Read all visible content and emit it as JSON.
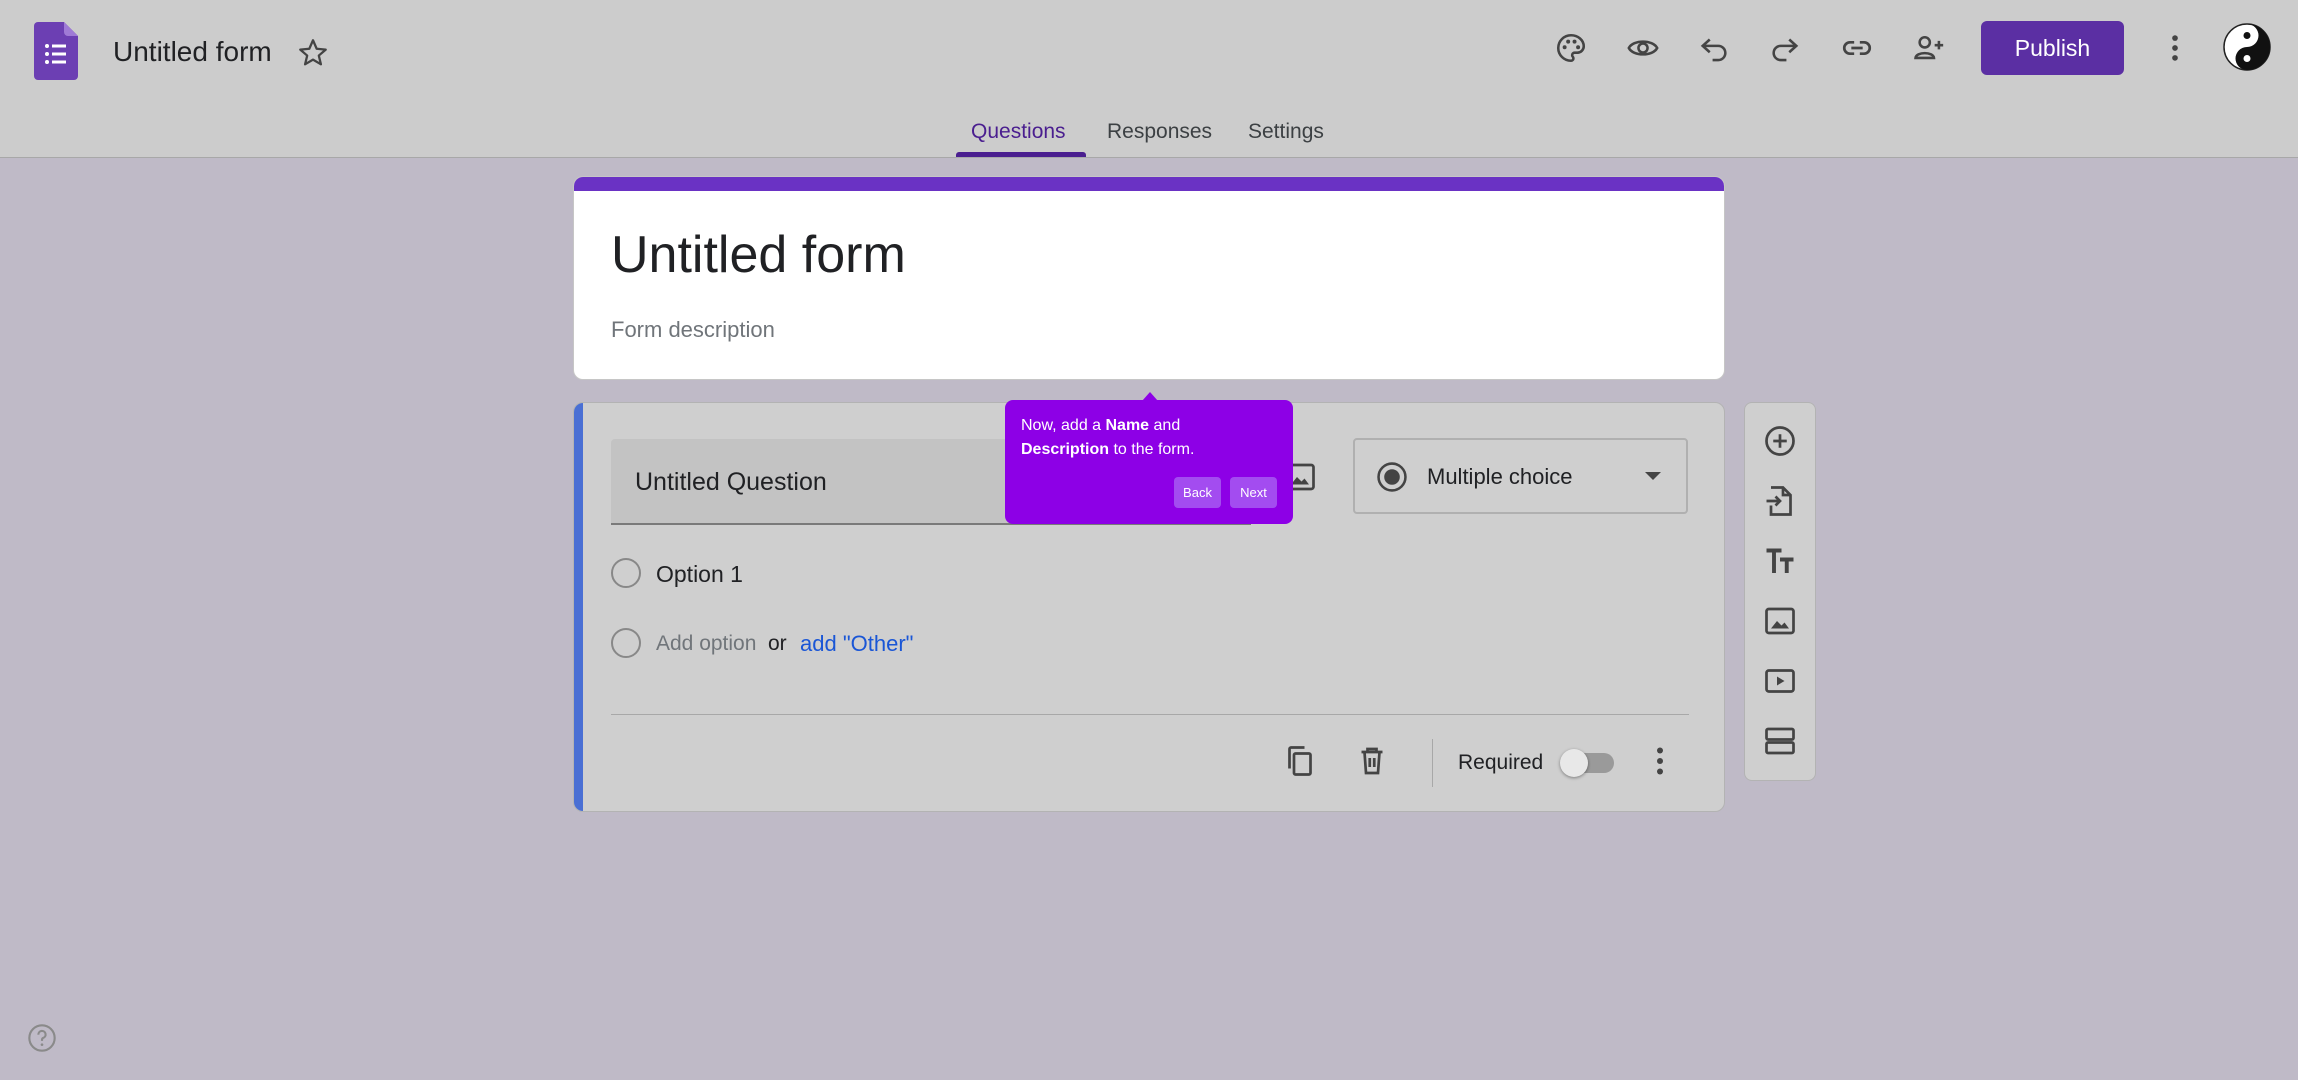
{
  "header": {
    "doc_title": "Untitled form",
    "publish_label": "Publish",
    "icons": [
      "palette-icon",
      "eye-icon",
      "undo-icon",
      "redo-icon",
      "link-icon",
      "add-person-icon",
      "more-vert-icon"
    ]
  },
  "tabs": [
    {
      "label": "Questions",
      "active": true
    },
    {
      "label": "Responses",
      "active": false
    },
    {
      "label": "Settings",
      "active": false
    }
  ],
  "form": {
    "title": "Untitled form",
    "description_placeholder": "Form description"
  },
  "question": {
    "title": "Untitled Question",
    "type": "Multiple choice",
    "options": [
      "Option 1"
    ],
    "add_option": "Add option",
    "or": "or",
    "add_other": "add \"Other\"",
    "required_label": "Required",
    "required": false
  },
  "tooltip": {
    "text_1": "Now, add a ",
    "bold_1": "Name",
    "text_2": " and ",
    "bold_2": "Description",
    "text_3": " to the form.",
    "back_label": "Back",
    "next_label": "Next"
  },
  "side_toolbar": [
    "add-question-icon",
    "import-questions-icon",
    "add-title-icon",
    "add-image-icon",
    "add-video-icon",
    "add-section-icon"
  ],
  "colors": {
    "accent": "#5b2fa3",
    "form_bar": "#6a32c4",
    "tooltip": "#8d00e6",
    "link": "#1a56d6",
    "question_bar": "#4a6fd4"
  }
}
